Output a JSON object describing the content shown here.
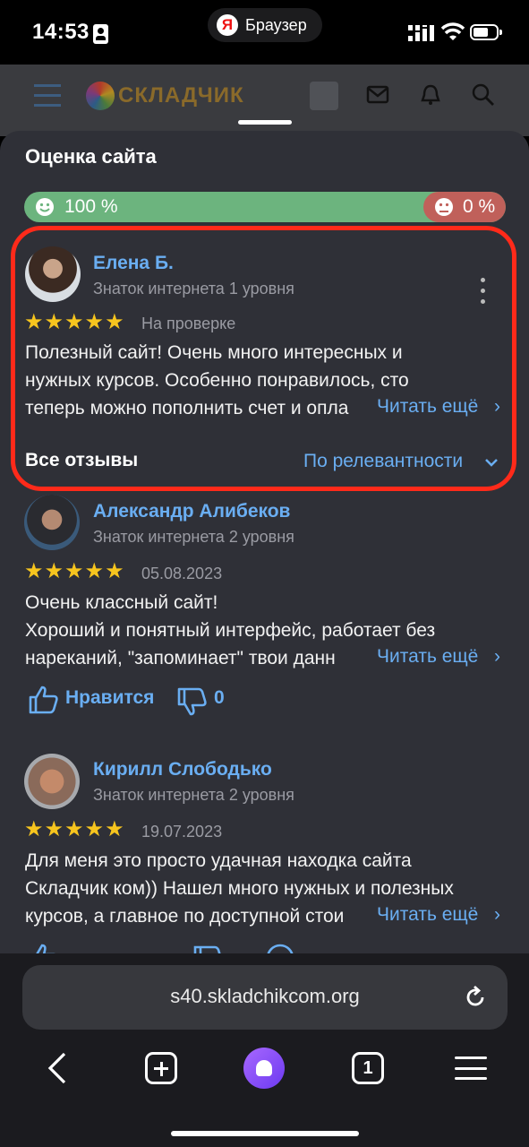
{
  "status": {
    "time": "14:53",
    "browser_label": "Браузер"
  },
  "site": {
    "logo_text": "СКЛАДЧИК"
  },
  "sheet": {
    "title": "Оценка сайта",
    "positive_pct": "100 %",
    "negative_pct": "0 %",
    "read_more": "Читать ещё",
    "all_reviews": "Все отзывы",
    "sort_label": "По релевантности"
  },
  "reviews": [
    {
      "name": "Елена Б.",
      "level": "Знаток интернета 1 уровня",
      "stars": "★★★★★",
      "date": "На проверке",
      "line1": "Полезный сайт! Очень много интересных и",
      "line2": "нужных курсов. Особенно понравилось, сто",
      "line3": "теперь можно пополнить счет и опла"
    },
    {
      "name": "Александр Алибеков",
      "level": "Знаток интернета 2 уровня",
      "stars": "★★★★★",
      "date": "05.08.2023",
      "line1": "Очень классный сайт!",
      "line2": "Хороший и понятный интерфейс, работает без",
      "line3": "нареканий, \"запоминает\" твои данн",
      "like_label": "Нравится",
      "dislike_count": "0"
    },
    {
      "name": "Кирилл Слободько",
      "level": "Знаток интернета 2 уровня",
      "stars": "★★★★★",
      "date": "19.07.2023",
      "line1": "Для меня это просто удачная находка сайта",
      "line2": "Складчик ком)) Нашел много нужных и полезных",
      "line3": "курсов, а главное по доступной стои"
    }
  ],
  "url": {
    "text": "s40.skladchikcom.org"
  },
  "tabs": {
    "count": "1"
  },
  "colors": {
    "positive": "#6cb47e",
    "negative": "#c0605a",
    "accent": "#6aaef2",
    "star": "#f7c51e",
    "highlight": "#ff2a1a"
  }
}
